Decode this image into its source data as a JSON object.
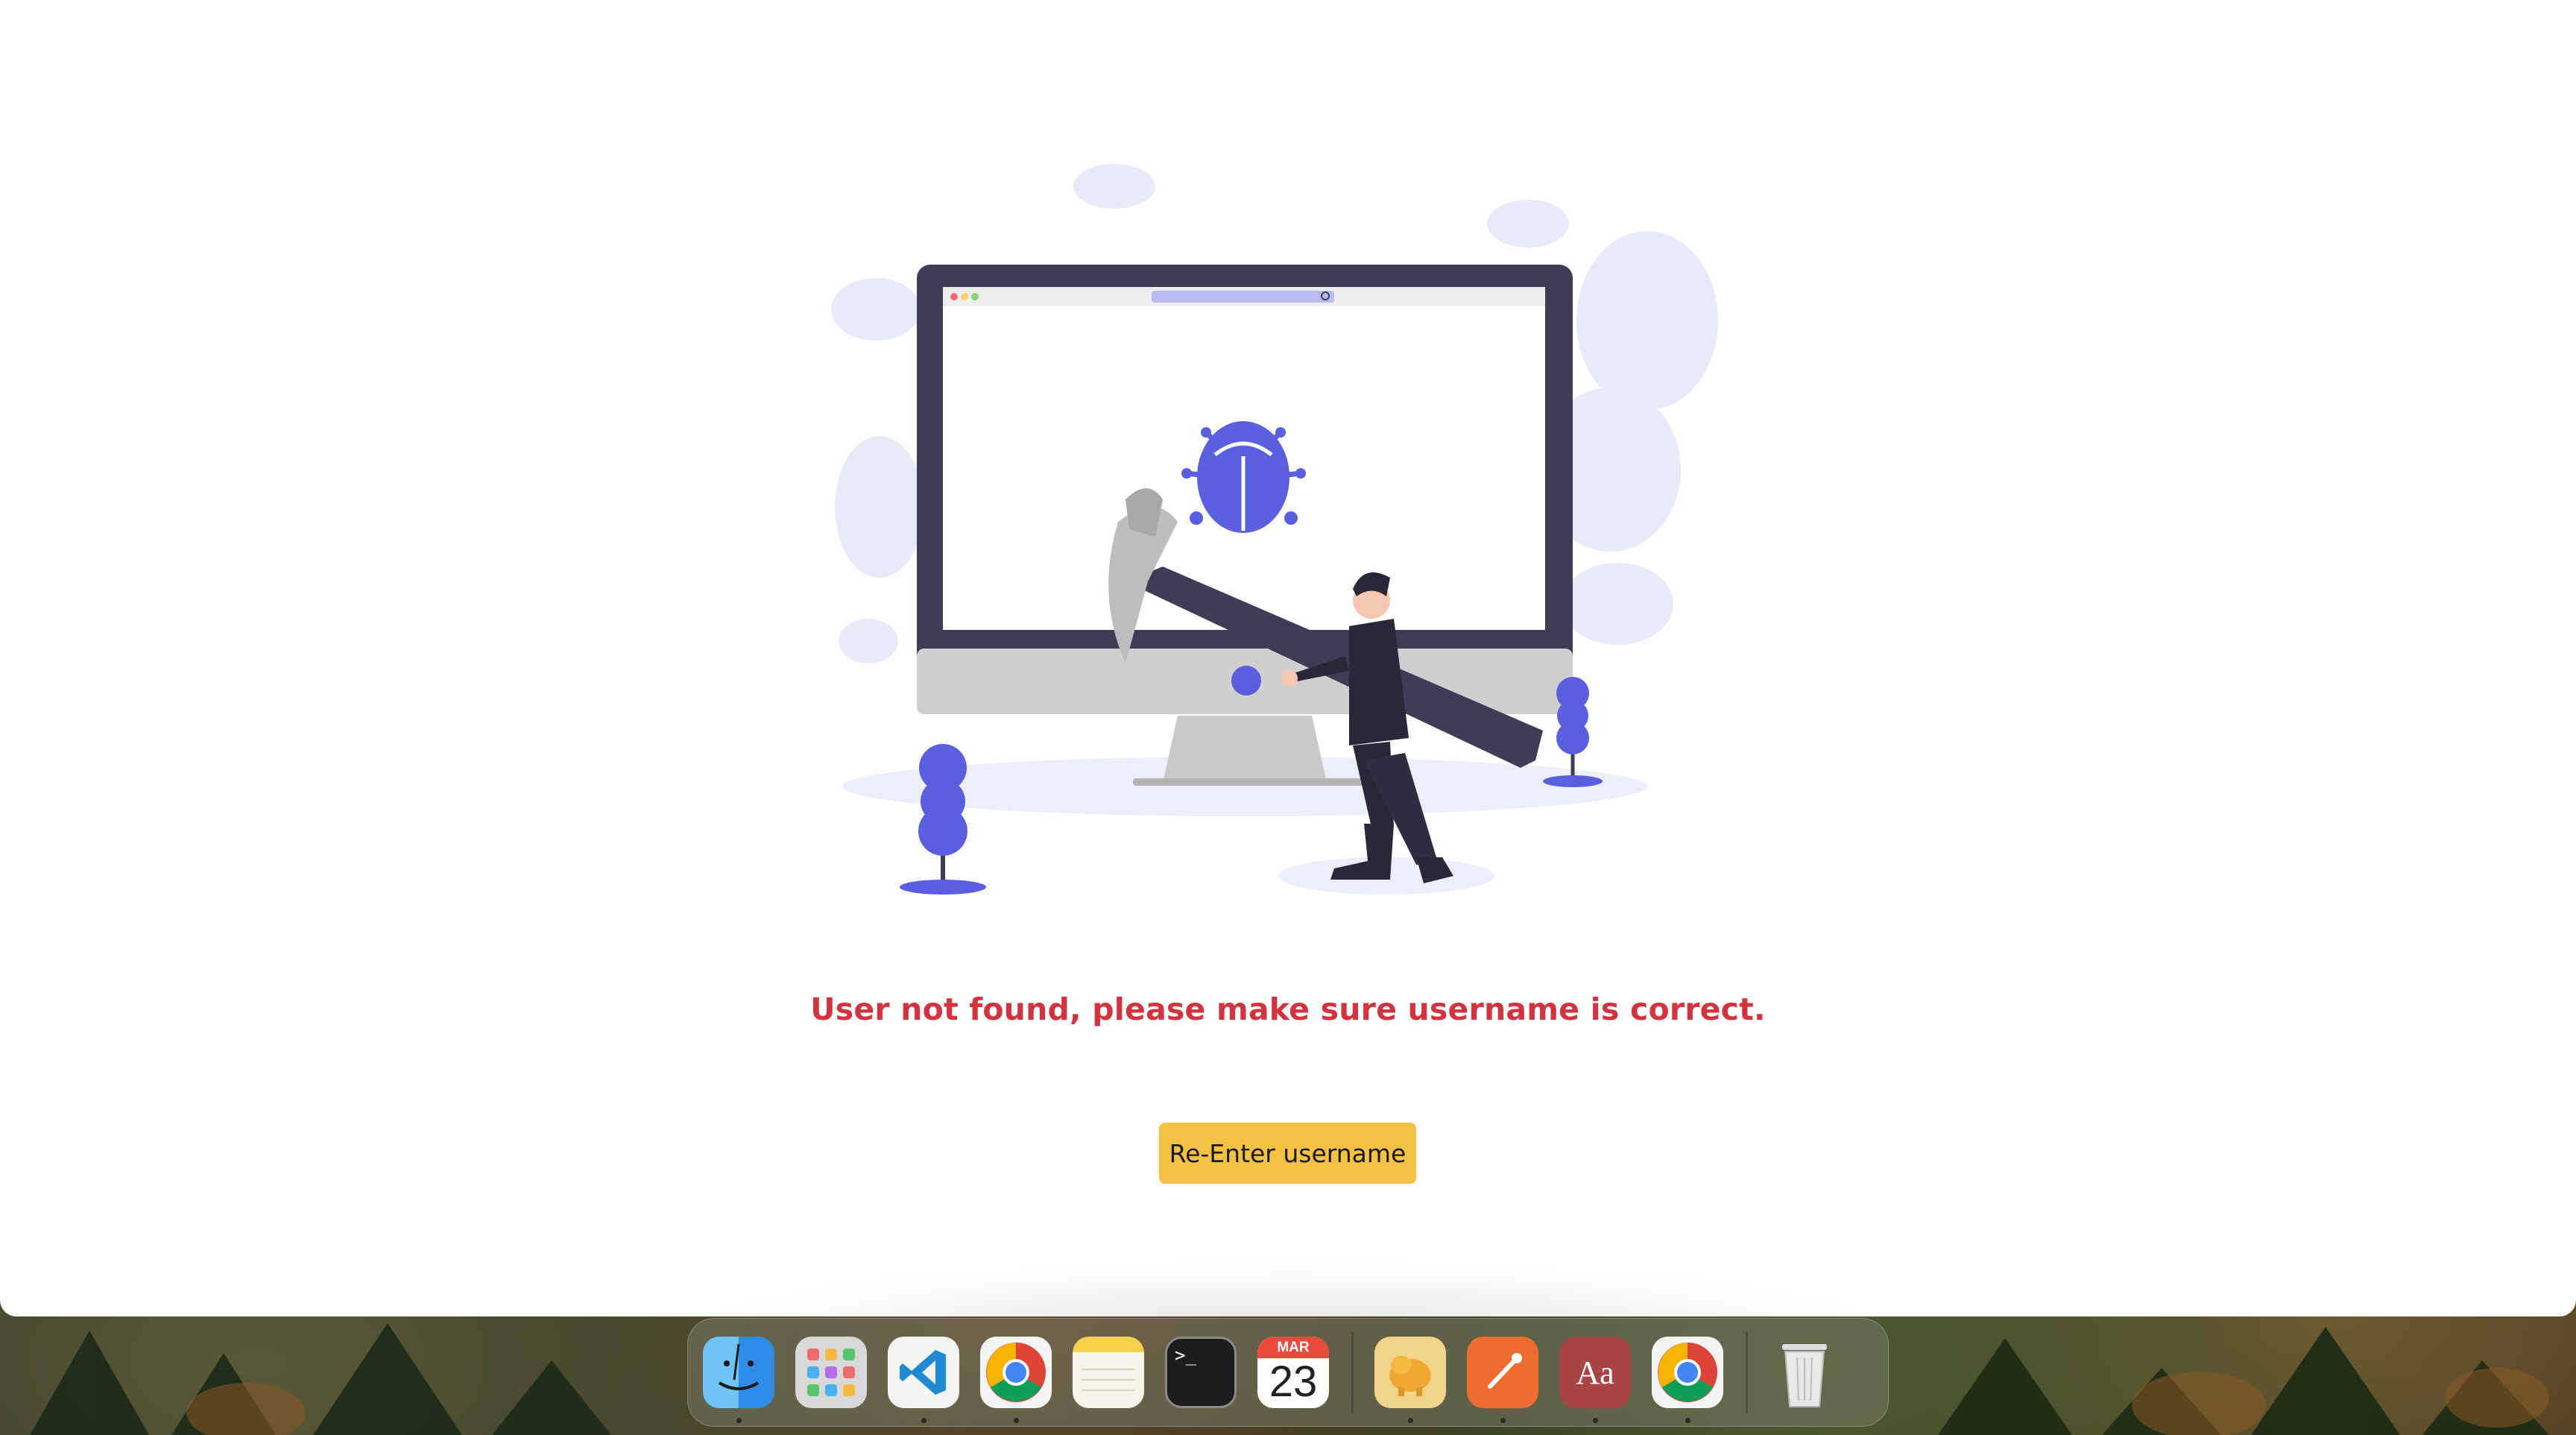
{
  "page": {
    "error_message": "User not found, please make sure username is correct.",
    "reenter_button_label": "Re-Enter username"
  },
  "colors": {
    "error_text": "#d2333f",
    "button_bg": "#f5c142",
    "accent_blue": "#5a5fe0",
    "monitor_frame": "#3f3d56"
  },
  "dock": {
    "apps": [
      {
        "name": "Finder",
        "icon": "finder-icon",
        "running": true
      },
      {
        "name": "Launchpad",
        "icon": "launchpad-icon",
        "running": false
      },
      {
        "name": "Visual Studio Code",
        "icon": "vscode-icon",
        "running": true
      },
      {
        "name": "Google Chrome",
        "icon": "chrome-icon",
        "running": true
      },
      {
        "name": "Notes",
        "icon": "notes-icon",
        "running": false
      },
      {
        "name": "Terminal",
        "icon": "terminal-icon",
        "running": false
      },
      {
        "name": "Calendar",
        "icon": "calendar-icon",
        "running": false
      },
      {
        "name": "TablePlus",
        "icon": "tableplus-icon",
        "running": true
      },
      {
        "name": "Postman",
        "icon": "postman-icon",
        "running": true
      },
      {
        "name": "Dictionary",
        "icon": "dictionary-icon",
        "running": true
      },
      {
        "name": "Google Chrome",
        "icon": "chrome-icon",
        "running": true
      },
      {
        "name": "Trash",
        "icon": "trash-icon",
        "running": false
      }
    ],
    "calendar_month": "MAR",
    "calendar_day": "23",
    "dictionary_glyph": "Aa",
    "terminal_glyph": ">_"
  }
}
